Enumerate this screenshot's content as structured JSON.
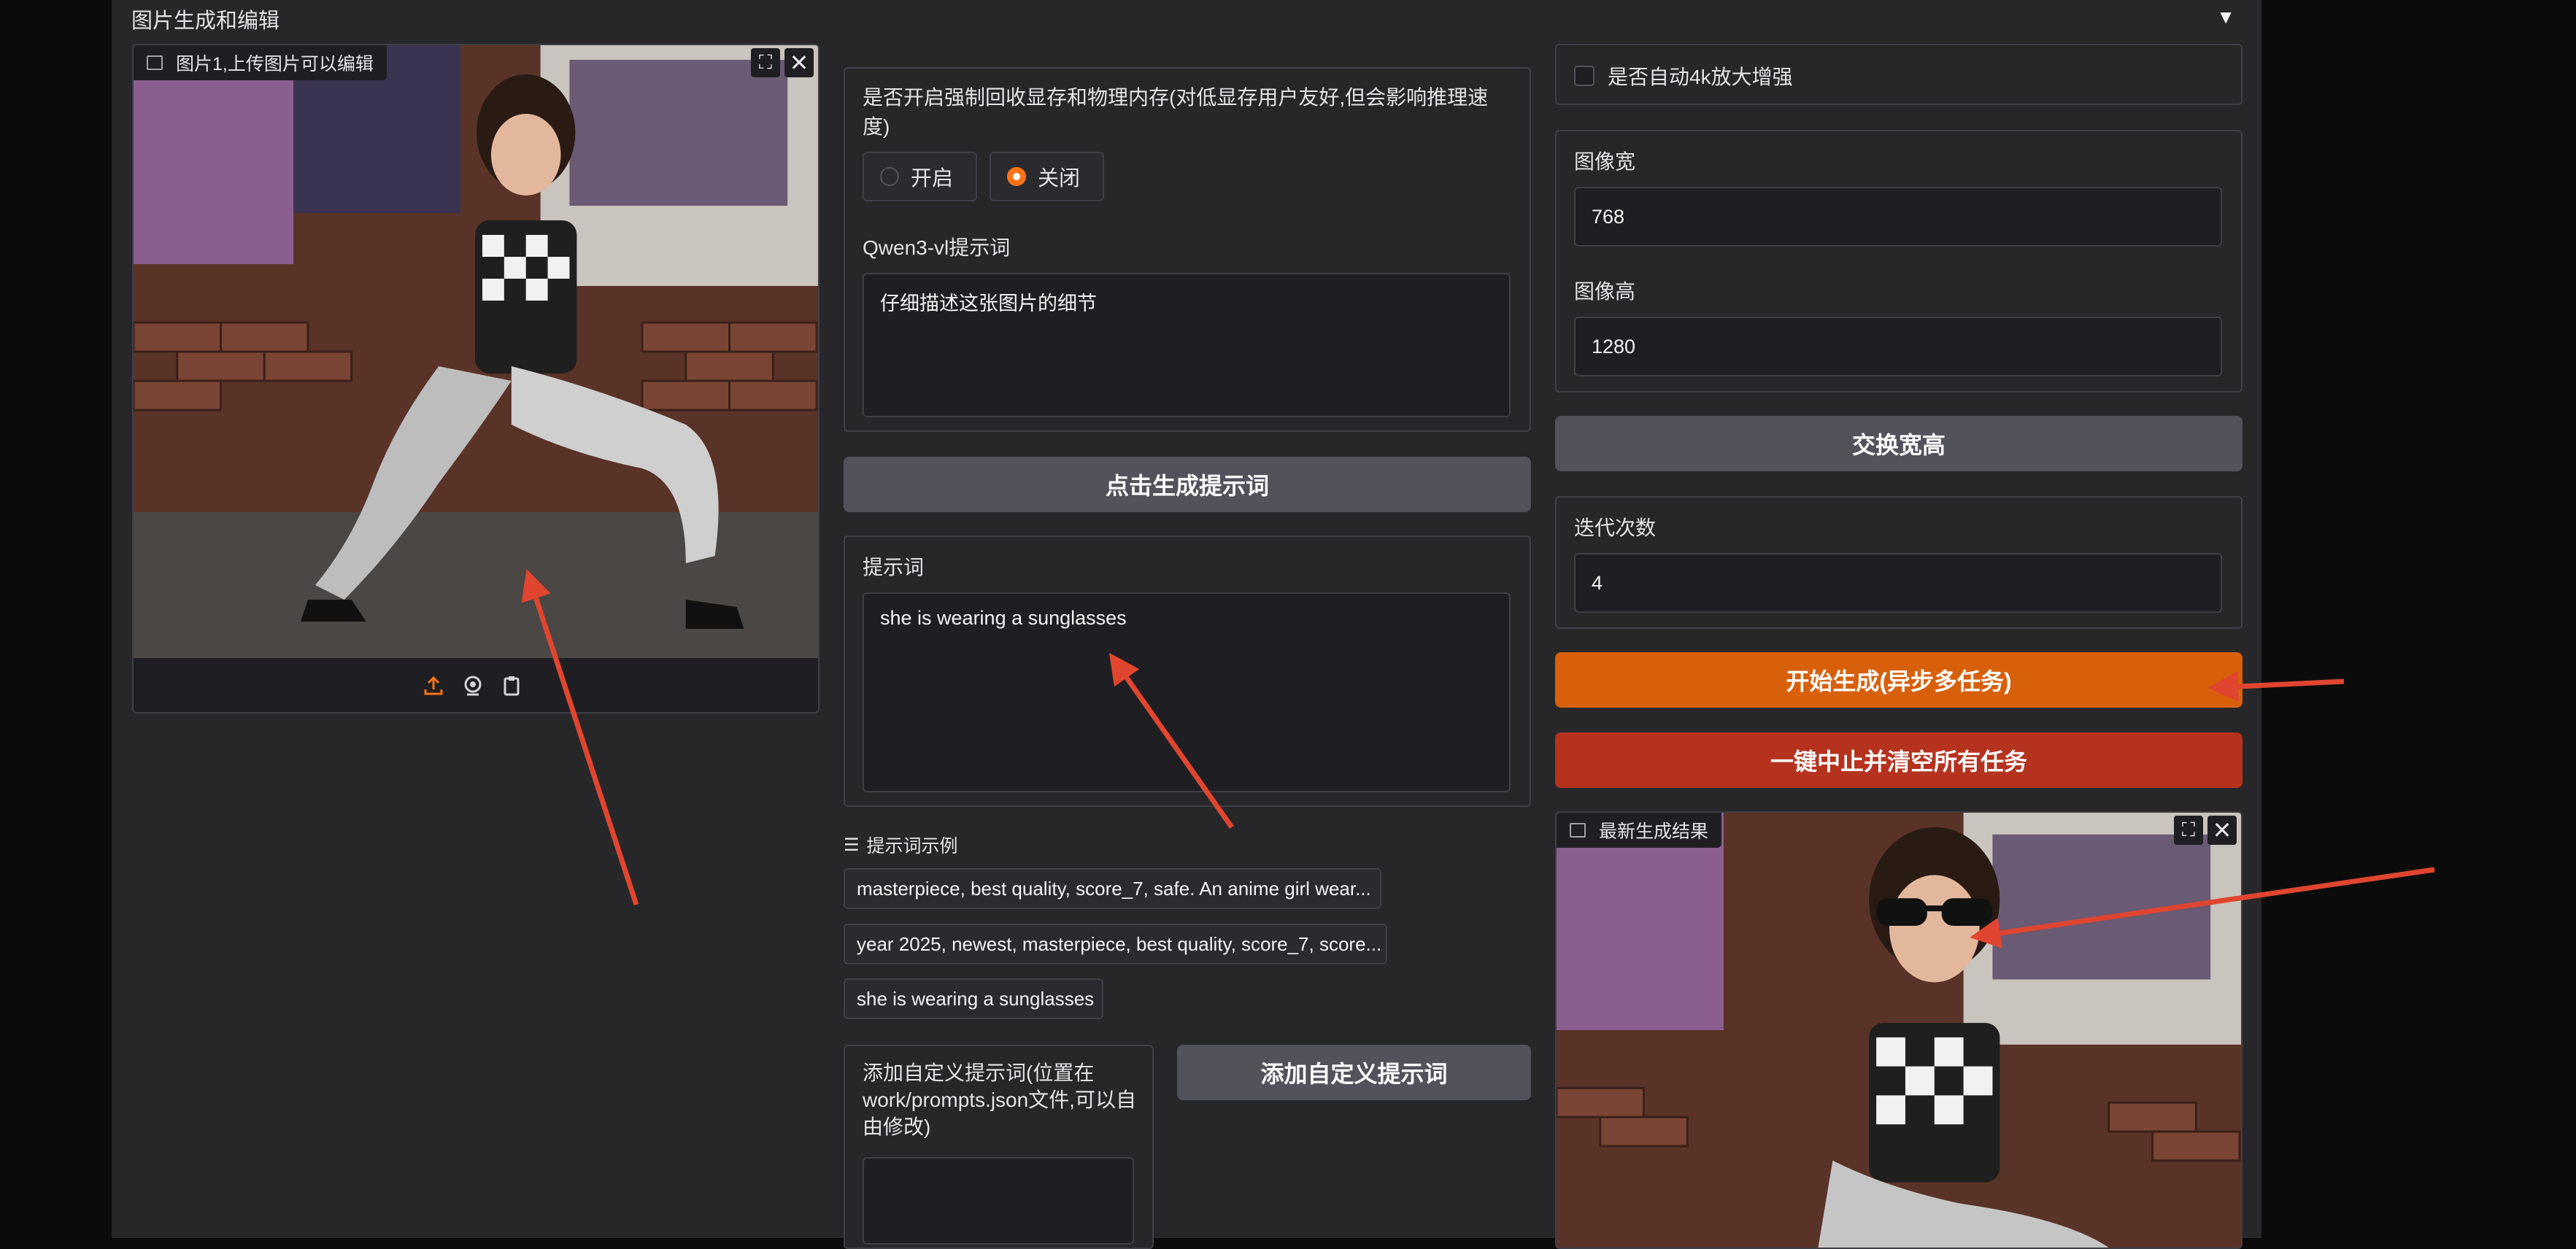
{
  "header": {
    "title": "图片生成和编辑",
    "toggle": "▼"
  },
  "input_image": {
    "label": "图片1,上传图片可以编辑"
  },
  "memory": {
    "label": "是否开启强制回收显存和物理内存(对低显存用户友好,但会影响推理速度)",
    "options": [
      "开启",
      "关闭"
    ],
    "selected": "关闭"
  },
  "qwen": {
    "label": "Qwen3-vl提示词",
    "value": "仔细描述这张图片的细节"
  },
  "gen_prompt_button": "点击生成提示词",
  "prompt": {
    "label": "提示词",
    "value": "she is wearing a sunglasses"
  },
  "examples": {
    "label": "提示词示例",
    "items": [
      "masterpiece, best quality, score_7, safe. An anime girl wear...",
      "year 2025, newest, masterpiece, best quality, score_7, score...",
      "she is wearing a sunglasses"
    ]
  },
  "custom": {
    "label": "添加自定义提示词(位置在work/prompts.json文件,可以自由修改)",
    "value": "",
    "button": "添加自定义提示词"
  },
  "upscale": {
    "label": "是否自动4k放大增强",
    "checked": false
  },
  "width": {
    "label": "图像宽",
    "value": "768"
  },
  "height": {
    "label": "图像高",
    "value": "1280"
  },
  "swap_button": "交换宽高",
  "steps": {
    "label": "迭代次数",
    "value": "4"
  },
  "start_button": "开始生成(异步多任务)",
  "stop_button": "一键中止并清空所有任务",
  "result": {
    "label": "最新生成结果"
  },
  "colors": {
    "accent": "#d8600a",
    "danger": "#b5321f",
    "annotation": "#e0452f",
    "panel": "#27272a"
  },
  "icons": [
    "image-icon",
    "fullscreen-icon",
    "close-icon",
    "upload-icon",
    "webcam-icon",
    "clipboard-icon",
    "list-icon",
    "radio-icon",
    "checkbox-icon"
  ]
}
